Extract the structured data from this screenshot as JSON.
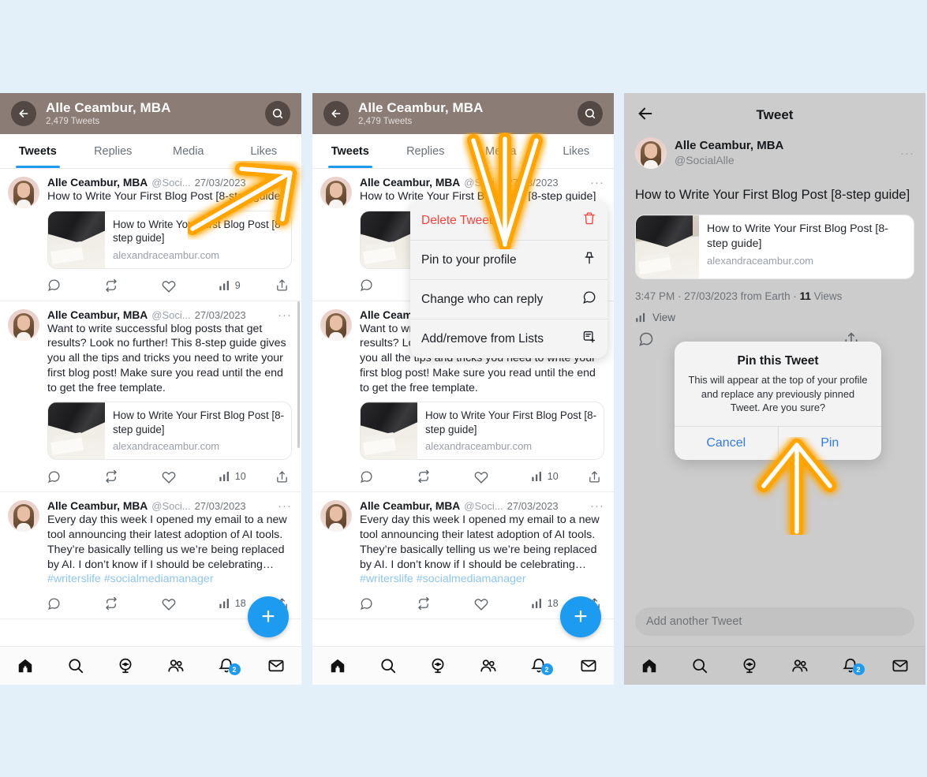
{
  "theme": {
    "page_background": "#e3eff9",
    "profile_header_background": "#8b7c76",
    "accent_blue": "#1d9bf0",
    "danger_red": "#f4433c",
    "link_blue": "#2f7bea",
    "annotation_orange": "#ffa800"
  },
  "profile": {
    "back_icon": "back-arrow-icon",
    "search_icon": "search-icon",
    "name": "Alle Ceambur, MBA",
    "tweet_count": "2,479 Tweets",
    "tabs": [
      {
        "label": "Tweets",
        "active": true
      },
      {
        "label": "Replies",
        "active": false
      },
      {
        "label": "Media",
        "active": false
      },
      {
        "label": "Likes",
        "active": false
      }
    ]
  },
  "tweets": [
    {
      "name": "Alle Ceambur, MBA",
      "handle": "@Soci...",
      "date": "27/03/2023",
      "more": "···",
      "text": "How to Write Your First Blog Post [8-step guide]",
      "card": {
        "title": "How to Write Your First Blog Post [8-step guide]",
        "url": "alexandraceambur.com"
      },
      "views": "9"
    },
    {
      "name": "Alle Ceambur, MBA",
      "handle": "@Soci...",
      "date": "27/03/2023",
      "more": "···",
      "text": "Want to write successful blog posts that get results? Look no further! This 8-step guide gives you all the tips and tricks you need to write your first blog post! Make sure you read until the end to get the free template.",
      "card": {
        "title": "How to Write Your First Blog Post [8-step guide]",
        "url": "alexandraceambur.com"
      },
      "views": "10"
    },
    {
      "name": "Alle Ceambur, MBA",
      "handle": "@Soci...",
      "date": "27/03/2023",
      "more": "···",
      "text": "Every day this week I opened my email to a new tool announcing their latest adoption of AI tools. They’re basically telling us we’re being replaced by AI. I don’t know if I should be celebrating… ",
      "hashtags": "#writerslife #socialmediamanager",
      "views": "18"
    }
  ],
  "compose_fab": {
    "label": "+",
    "icon": "plus-icon"
  },
  "bottom_nav": [
    {
      "icon": "home-icon",
      "label": "Home",
      "badge": ""
    },
    {
      "icon": "search-icon",
      "label": "Search",
      "badge": ""
    },
    {
      "icon": "spaces-icon",
      "label": "Spaces",
      "badge": ""
    },
    {
      "icon": "communities-icon",
      "label": "Communities",
      "badge": ""
    },
    {
      "icon": "notifications-icon",
      "label": "Notifications",
      "badge": "2"
    },
    {
      "icon": "messages-icon",
      "label": "Messages",
      "badge": ""
    }
  ],
  "dropdown_menu": {
    "items": [
      {
        "label": "Delete Tweet",
        "icon": "trash-icon",
        "danger": true
      },
      {
        "label": "Pin to your profile",
        "icon": "pin-icon",
        "danger": false
      },
      {
        "label": "Change who can reply",
        "icon": "speech-bubble-icon",
        "danger": false
      },
      {
        "label": "Add/remove from Lists",
        "icon": "list-add-icon",
        "danger": false
      }
    ]
  },
  "tweet_detail": {
    "back_icon": "back-arrow-icon",
    "title": "Tweet",
    "author_name": "Alle Ceambur, MBA",
    "author_handle": "@SocialAlle",
    "more": "···",
    "text": "How to Write Your First Blog Post [8-step guide]",
    "card": {
      "title": "How to Write Your First Blog Post [8-step guide]",
      "url": "alexandraceambur.com"
    },
    "meta_time": "3:47 PM",
    "meta_full": "3:47 PM · 27/03/2023 from Earth · ",
    "meta_views_count": "11",
    "meta_views_label": " Views",
    "analytics_label": "View",
    "compose_placeholder": "Add another Tweet"
  },
  "pin_alert": {
    "title": "Pin this Tweet",
    "message": "This will appear at the top of your profile and replace any previously pinned Tweet. Are you sure?",
    "cancel_label": "Cancel",
    "confirm_label": "Pin"
  },
  "annotations": [
    {
      "name": "arrow-to-more-menu",
      "direction": "up-right",
      "target": "tweet-more-button"
    },
    {
      "name": "arrow-to-pin-option",
      "direction": "down",
      "target": "menu-item-pin-to-your-profile"
    },
    {
      "name": "arrow-to-pin-confirm",
      "direction": "up",
      "target": "alert-pin-button"
    }
  ]
}
